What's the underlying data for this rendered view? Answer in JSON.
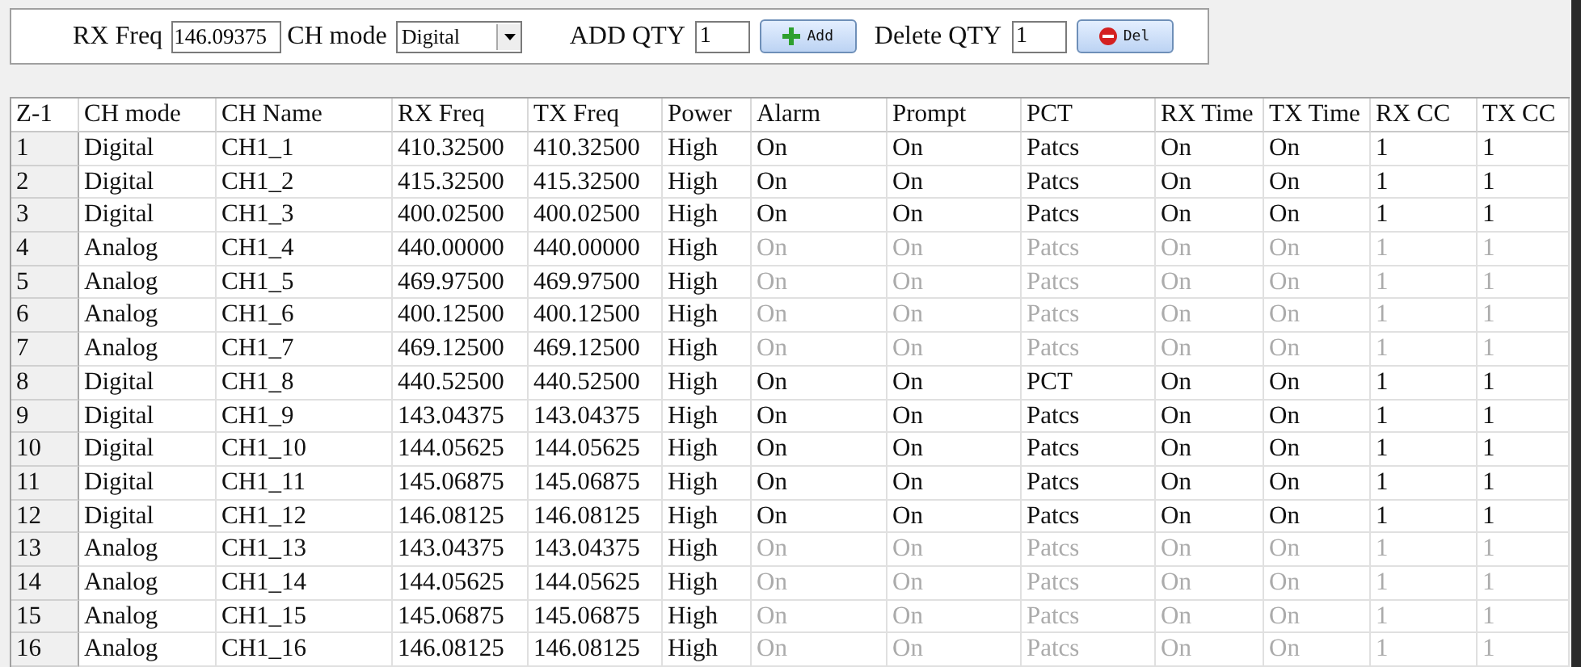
{
  "toolbar": {
    "rx_freq_label": "RX Freq",
    "rx_freq_value": "146.09375",
    "ch_mode_label": "CH mode",
    "ch_mode_value": "Digital",
    "add_qty_label": "ADD QTY",
    "add_qty_value": "1",
    "add_button": "Add",
    "delete_qty_label": "Delete QTY",
    "delete_qty_value": "1",
    "delete_button": "Del"
  },
  "table": {
    "columns": [
      "Z-1",
      "CH mode",
      "CH Name",
      "RX Freq",
      "TX Freq",
      "Power",
      "Alarm",
      "Prompt",
      "PCT",
      "RX Time",
      "TX Time",
      "RX CC",
      "TX CC"
    ],
    "rows": [
      {
        "cells": [
          "1",
          "Digital",
          "CH1_1",
          "410.32500",
          "410.32500",
          "High",
          "On",
          "On",
          "Patcs",
          "On",
          "On",
          "1",
          "1"
        ],
        "options_disabled": false
      },
      {
        "cells": [
          "2",
          "Digital",
          "CH1_2",
          "415.32500",
          "415.32500",
          "High",
          "On",
          "On",
          "Patcs",
          "On",
          "On",
          "1",
          "1"
        ],
        "options_disabled": false
      },
      {
        "cells": [
          "3",
          "Digital",
          "CH1_3",
          "400.02500",
          "400.02500",
          "High",
          "On",
          "On",
          "Patcs",
          "On",
          "On",
          "1",
          "1"
        ],
        "options_disabled": false
      },
      {
        "cells": [
          "4",
          "Analog",
          "CH1_4",
          "440.00000",
          "440.00000",
          "High",
          "On",
          "On",
          "Patcs",
          "On",
          "On",
          "1",
          "1"
        ],
        "options_disabled": true
      },
      {
        "cells": [
          "5",
          "Analog",
          "CH1_5",
          "469.97500",
          "469.97500",
          "High",
          "On",
          "On",
          "Patcs",
          "On",
          "On",
          "1",
          "1"
        ],
        "options_disabled": true
      },
      {
        "cells": [
          "6",
          "Analog",
          "CH1_6",
          "400.12500",
          "400.12500",
          "High",
          "On",
          "On",
          "Patcs",
          "On",
          "On",
          "1",
          "1"
        ],
        "options_disabled": true
      },
      {
        "cells": [
          "7",
          "Analog",
          "CH1_7",
          "469.12500",
          "469.12500",
          "High",
          "On",
          "On",
          "Patcs",
          "On",
          "On",
          "1",
          "1"
        ],
        "options_disabled": true
      },
      {
        "cells": [
          "8",
          "Digital",
          "CH1_8",
          "440.52500",
          "440.52500",
          "High",
          "On",
          "On",
          "PCT",
          "On",
          "On",
          "1",
          "1"
        ],
        "options_disabled": false
      },
      {
        "cells": [
          "9",
          "Digital",
          "CH1_9",
          "143.04375",
          "143.04375",
          "High",
          "On",
          "On",
          "Patcs",
          "On",
          "On",
          "1",
          "1"
        ],
        "options_disabled": false
      },
      {
        "cells": [
          "10",
          "Digital",
          "CH1_10",
          "144.05625",
          "144.05625",
          "High",
          "On",
          "On",
          "Patcs",
          "On",
          "On",
          "1",
          "1"
        ],
        "options_disabled": false
      },
      {
        "cells": [
          "11",
          "Digital",
          "CH1_11",
          "145.06875",
          "145.06875",
          "High",
          "On",
          "On",
          "Patcs",
          "On",
          "On",
          "1",
          "1"
        ],
        "options_disabled": false
      },
      {
        "cells": [
          "12",
          "Digital",
          "CH1_12",
          "146.08125",
          "146.08125",
          "High",
          "On",
          "On",
          "Patcs",
          "On",
          "On",
          "1",
          "1"
        ],
        "options_disabled": false
      },
      {
        "cells": [
          "13",
          "Analog",
          "CH1_13",
          "143.04375",
          "143.04375",
          "High",
          "On",
          "On",
          "Patcs",
          "On",
          "On",
          "1",
          "1"
        ],
        "options_disabled": true
      },
      {
        "cells": [
          "14",
          "Analog",
          "CH1_14",
          "144.05625",
          "144.05625",
          "High",
          "On",
          "On",
          "Patcs",
          "On",
          "On",
          "1",
          "1"
        ],
        "options_disabled": true
      },
      {
        "cells": [
          "15",
          "Analog",
          "CH1_15",
          "145.06875",
          "145.06875",
          "High",
          "On",
          "On",
          "Patcs",
          "On",
          "On",
          "1",
          "1"
        ],
        "options_disabled": true
      },
      {
        "cells": [
          "16",
          "Analog",
          "CH1_16",
          "146.08125",
          "146.08125",
          "High",
          "On",
          "On",
          "Patcs",
          "On",
          "On",
          "1",
          "1"
        ],
        "options_disabled": true
      }
    ]
  }
}
